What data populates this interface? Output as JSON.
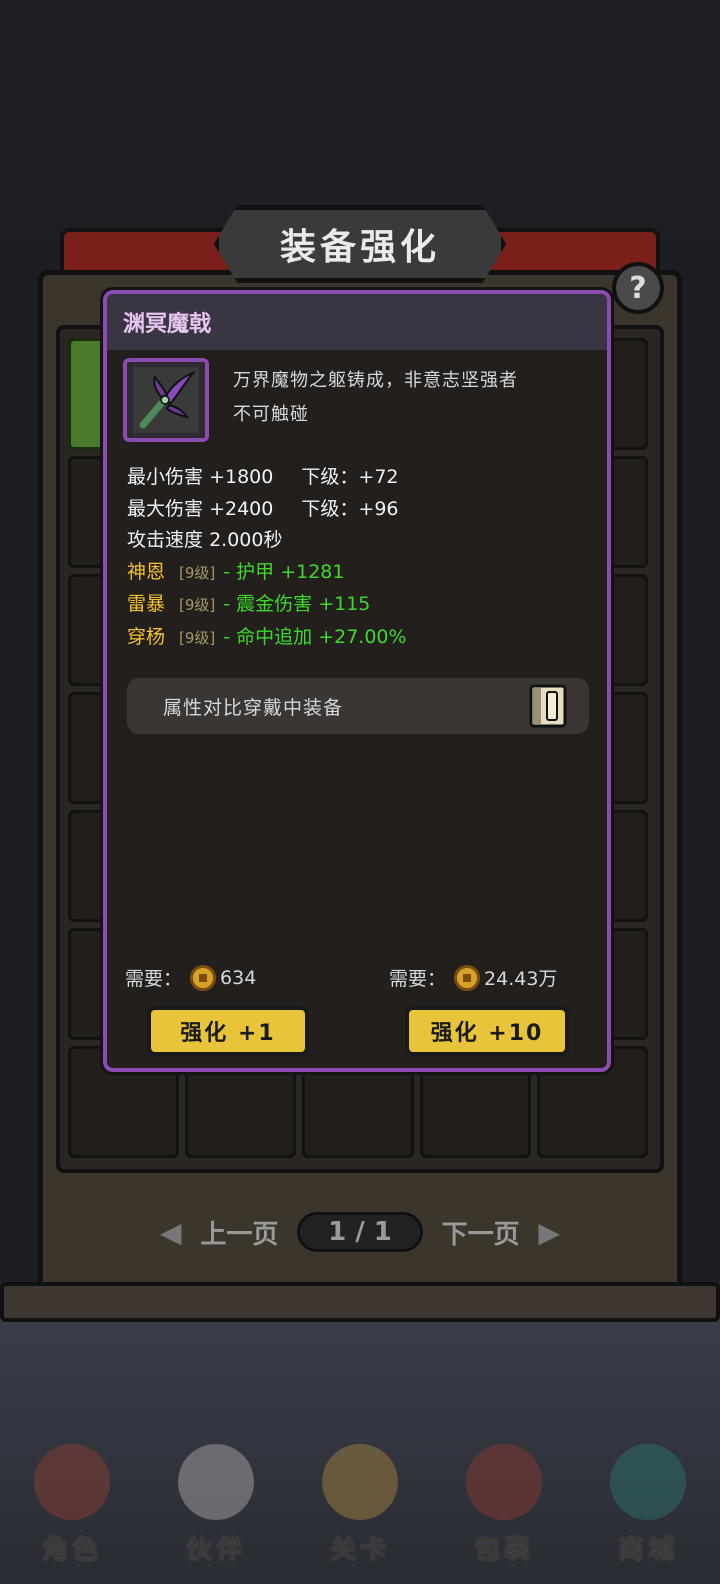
{
  "screen": {
    "title": "装备强化",
    "help_label": "?"
  },
  "item": {
    "name": "渊冥魔戟",
    "description_line1": "万界魔物之躯铸成，非意志坚强者",
    "description_line2": "不可触碰",
    "stats": [
      {
        "label": "最小伤害",
        "value": "+1800",
        "next_label": "下级：",
        "next_value": "+72"
      },
      {
        "label": "最大伤害",
        "value": "+2400",
        "next_label": "下级：",
        "next_value": "+96"
      },
      {
        "label": "攻击速度",
        "value": "2.000秒"
      }
    ],
    "affixes": [
      {
        "name": "神恩",
        "level": "[9级]",
        "text": "- 护甲 +1281"
      },
      {
        "name": "雷暴",
        "level": "[9级]",
        "text": "- 震金伤害 +115"
      },
      {
        "name": "穿杨",
        "level": "[9级]",
        "text": "- 命中追加 +27.00%"
      }
    ]
  },
  "compare_label": "属性对比穿戴中装备",
  "upgrade": {
    "cost_label": "需要：",
    "cost_1": "634",
    "cost_10": "24.43万",
    "button_1": "强化 +1",
    "button_10": "强化 +10"
  },
  "pager": {
    "prev": "上一页",
    "page": "1 / 1",
    "next": "下一页"
  },
  "nav": [
    {
      "label": "角色"
    },
    {
      "label": "伙伴"
    },
    {
      "label": "关卡"
    },
    {
      "label": "包裹"
    },
    {
      "label": "商城"
    }
  ],
  "colors": {
    "rarity_purple": "#8c4bb0",
    "affix_gold": "#f2c230",
    "affix_green": "#3ed82b",
    "button_yellow": "#e8c43a"
  }
}
